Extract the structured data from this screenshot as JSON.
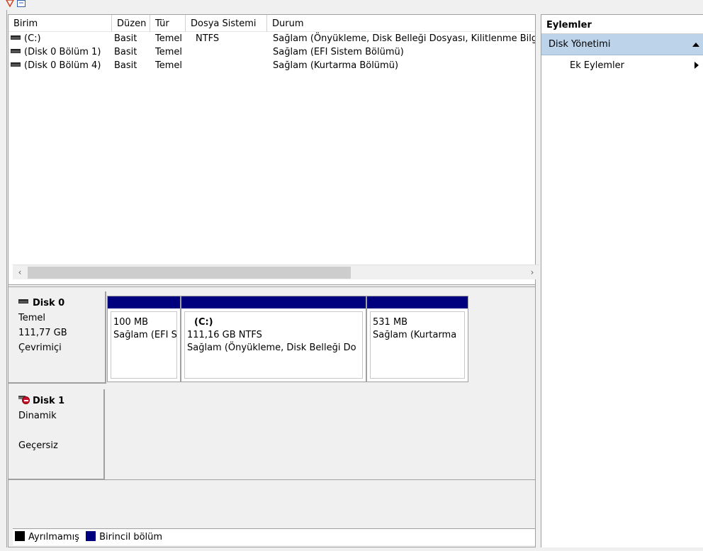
{
  "volume_list": {
    "columns": [
      "Birim",
      "Düzen",
      "Tür",
      "Dosya Sistemi",
      "Durum"
    ],
    "rows": [
      {
        "birim": "(C:)",
        "duzen": "Basit",
        "tur": "Temel",
        "dosya_sistemi": "NTFS",
        "durum": "Sağlam (Önyükleme, Disk Belleği Dosyası, Kilitlenme Bilg"
      },
      {
        "birim": "(Disk 0 Bölüm 1)",
        "duzen": "Basit",
        "tur": "Temel",
        "dosya_sistemi": "",
        "durum": "Sağlam (EFI Sistem Bölümü)"
      },
      {
        "birim": "(Disk 0 Bölüm 4)",
        "duzen": "Basit",
        "tur": "Temel",
        "dosya_sistemi": "",
        "durum": "Sağlam (Kurtarma Bölümü)"
      }
    ]
  },
  "scrollbar": {
    "left_arrow": "‹",
    "right_arrow": "›"
  },
  "disks": [
    {
      "name": "Disk 0",
      "type": "Temel",
      "size": "111,77 GB",
      "status": "Çevrimiçi",
      "partitions": [
        {
          "name": "",
          "size": "100 MB",
          "status": "Sağlam (EFI S"
        },
        {
          "name": "(C:)",
          "size": "111,16 GB NTFS",
          "status": "Sağlam (Önyükleme, Disk Belleği Do"
        },
        {
          "name": "",
          "size": "531 MB",
          "status": "Sağlam (Kurtarma"
        }
      ]
    },
    {
      "name": "Disk 1",
      "type": "Dinamik",
      "size": "",
      "status": "Geçersiz"
    }
  ],
  "legend": {
    "unallocated": "Ayrılmamış",
    "primary": "Birincil bölüm"
  },
  "actions": {
    "title": "Eylemler",
    "section": "Disk Yönetimi",
    "item": "Ek Eylemler"
  },
  "colors": {
    "partition_bar": "#00007f",
    "selection": "#bcd3ea",
    "error": "#c8102e"
  }
}
